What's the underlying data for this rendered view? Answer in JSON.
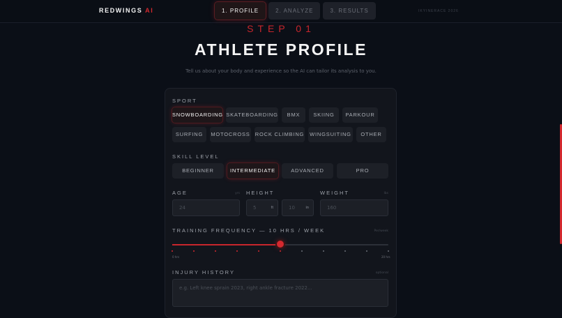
{
  "brand": {
    "name": "REDWINGS",
    "accent": "AI"
  },
  "steps": [
    {
      "label": "1. PROFILE",
      "active": true
    },
    {
      "label": "2. ANALYZE",
      "active": false
    },
    {
      "label": "3. RESULTS",
      "active": false
    }
  ],
  "credit": "IKYINERACE 2026",
  "header": {
    "kicker": "STEP 01",
    "title": "ATHLETE PROFILE",
    "subtitle": "Tell us about your body and experience so the AI can tailor its analysis to you."
  },
  "sport": {
    "label": "SPORT",
    "selected": "SNOWBOARDING",
    "row1": [
      "SNOWBOARDING",
      "SKATEBOARDING",
      "BMX",
      "SKIING",
      "PARKOUR"
    ],
    "row2": [
      "SURFING",
      "MOTOCROSS",
      "ROCK CLIMBING",
      "WINGSUITING",
      "OTHER"
    ]
  },
  "skill": {
    "label": "SKILL LEVEL",
    "selected": "INTERMEDIATE",
    "options": [
      "BEGINNER",
      "INTERMEDIATE",
      "ADVANCED",
      "PRO"
    ]
  },
  "age": {
    "label": "AGE",
    "hint": "yrs",
    "placeholder": "24"
  },
  "height": {
    "label": "HEIGHT",
    "feet_placeholder": "5",
    "feet_unit": "ft",
    "inches_placeholder": "10",
    "inches_unit": "in"
  },
  "weight": {
    "label": "WEIGHT",
    "hint": "lbs",
    "placeholder": "160"
  },
  "training": {
    "label": "TRAINING FREQUENCY — 10 HRS / WEEK",
    "hint": "Per/week",
    "value": 10,
    "min": 0,
    "max": 20,
    "min_label": "0 hrs",
    "max_label": "20 hrs"
  },
  "injury": {
    "label": "INJURY HISTORY",
    "hint": "optional",
    "placeholder": "e.g. Left knee sprain 2023, right ankle fracture 2022..."
  },
  "colors": {
    "accent": "#d4292f",
    "background": "#0b0f17",
    "card": "#12151c"
  }
}
